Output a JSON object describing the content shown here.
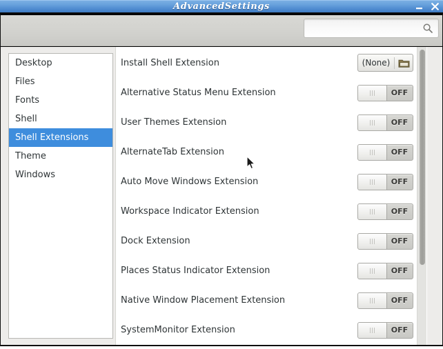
{
  "window": {
    "title": "AdvancedSettings",
    "minimize_label": "minimize",
    "close_label": "close"
  },
  "search": {
    "value": "",
    "placeholder": "",
    "icon": "search-icon"
  },
  "sidebar": {
    "items": [
      {
        "label": "Desktop",
        "selected": false
      },
      {
        "label": "Files",
        "selected": false
      },
      {
        "label": "Fonts",
        "selected": false
      },
      {
        "label": "Shell",
        "selected": false
      },
      {
        "label": "Shell Extensions",
        "selected": true
      },
      {
        "label": "Theme",
        "selected": false
      },
      {
        "label": "Windows",
        "selected": false
      }
    ],
    "selected_color": "#3e8ddd"
  },
  "content": {
    "rows": [
      {
        "label": "Install Shell Extension",
        "control": "filechooser",
        "value": "(None)",
        "icon": "folder-open-icon"
      },
      {
        "label": "Alternative Status Menu Extension",
        "control": "switch",
        "value": "OFF"
      },
      {
        "label": "User Themes Extension",
        "control": "switch",
        "value": "OFF"
      },
      {
        "label": "AlternateTab Extension",
        "control": "switch",
        "value": "OFF"
      },
      {
        "label": "Auto Move Windows Extension",
        "control": "switch",
        "value": "OFF"
      },
      {
        "label": "Workspace Indicator Extension",
        "control": "switch",
        "value": "OFF"
      },
      {
        "label": "Dock Extension",
        "control": "switch",
        "value": "OFF"
      },
      {
        "label": "Places Status Indicator Extension",
        "control": "switch",
        "value": "OFF"
      },
      {
        "label": "Native Window Placement Extension",
        "control": "switch",
        "value": "OFF"
      },
      {
        "label": "SystemMonitor Extension",
        "control": "switch",
        "value": "OFF"
      }
    ]
  },
  "scrollbar": {
    "orientation": "vertical",
    "thumb_top_pct": 1,
    "thumb_height_pct": 72
  }
}
